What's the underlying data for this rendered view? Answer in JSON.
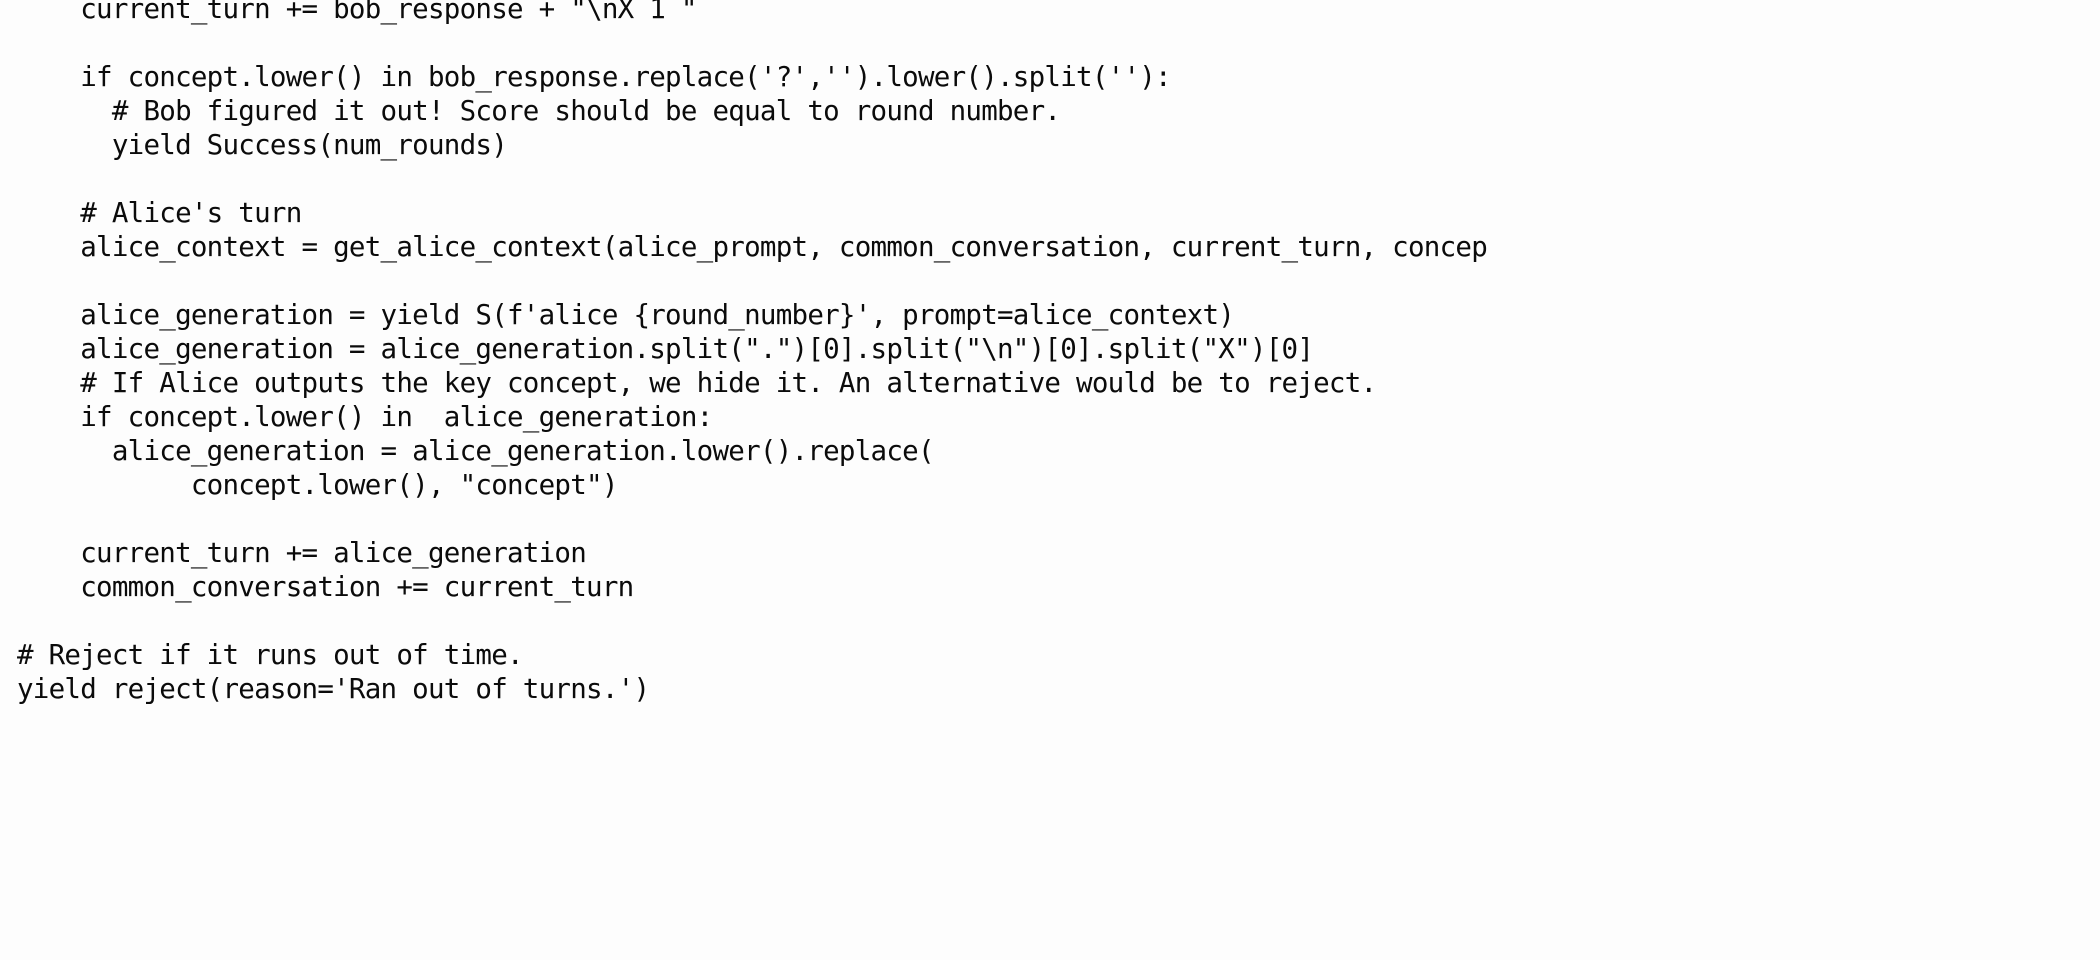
{
  "document": {
    "kind": "code-listing",
    "language": "Python",
    "background_color": "#fdfdfd",
    "text_color": "#0b0b0b",
    "right_edge_clipped": true,
    "clipped_line_index": 6
  },
  "code": {
    "lines": [
      "    current_turn += bob_response + \"\\nX 1 \"",
      "",
      "    if concept.lower() in bob_response.replace('?','').lower().split(''):",
      "      # Bob figured it out! Score should be equal to round number.",
      "      yield Success(num_rounds)",
      "",
      "    # Alice's turn",
      "    alice_context = get_alice_context(alice_prompt, common_conversation, current_turn, concep",
      "",
      "    alice_generation = yield S(f'alice {round_number}', prompt=alice_context)",
      "    alice_generation = alice_generation.split(\".\")[0].split(\"\\n\")[0].split(\"X\")[0]",
      "    # If Alice outputs the key concept, we hide it. An alternative would be to reject.",
      "    if concept.lower() in  alice_generation:",
      "      alice_generation = alice_generation.lower().replace(",
      "           concept.lower(), \"concept\")",
      "",
      "    current_turn += alice_generation",
      "    common_conversation += current_turn",
      "",
      "# Reject if it runs out of time.",
      "yield reject(reason='Ran out of turns.')"
    ]
  }
}
